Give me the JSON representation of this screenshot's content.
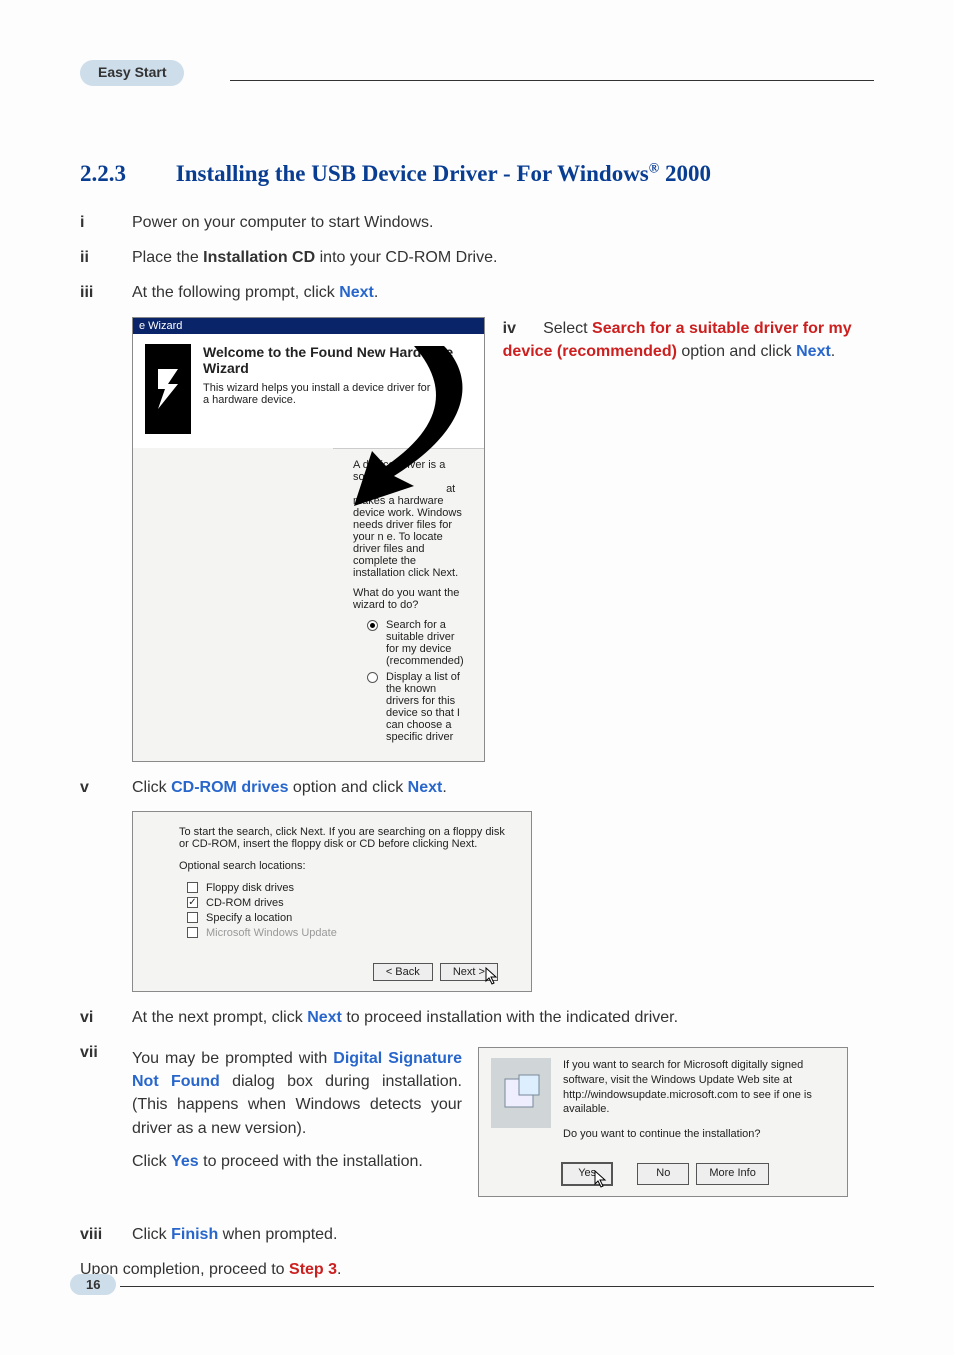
{
  "header_pill": "Easy Start",
  "section": {
    "number": "2.2.3",
    "title_main": "Installing the USB Device Driver - For Windows",
    "title_suffix": " 2000"
  },
  "steps": {
    "i": {
      "k": "i",
      "t1": "Power on your computer to start Windows."
    },
    "ii": {
      "k": "ii",
      "t1": "Place the ",
      "b1": "Installation CD",
      "t2": " into your CD-ROM Drive."
    },
    "iii": {
      "k": "iii",
      "t1": "At the following prompt, click ",
      "l1": "Next",
      "t2": "."
    },
    "iv": {
      "k": "iv",
      "t1": "Select ",
      "r1": "Search for a suitable driver for my device (recommended)",
      "t2": " option and click ",
      "l1": "Next",
      "t3": "."
    },
    "v": {
      "k": "v",
      "t1": "Click ",
      "l1": "CD-ROM drives",
      "t2": " option and click ",
      "l2": "Next",
      "t3": "."
    },
    "vi": {
      "k": "vi",
      "t1": "At the next prompt, click ",
      "l1": "Next",
      "t2": " to proceed installation with the indicated driver."
    },
    "vii": {
      "k": "vii",
      "p1a": "You may be prompted with ",
      "p1b": "Digital Signature Not Found",
      "p1c": " dialog box during installation.  (This happens when Windows detects your driver as a new version).",
      "p2a": "Click ",
      "p2b": "Yes",
      "p2c": " to proceed with the installation."
    },
    "viii": {
      "k": "viii",
      "t1": "Click ",
      "l1": "Finish",
      "t2": " when prompted."
    },
    "final": {
      "t1": "Upon completion, proceed to ",
      "l1": "Step 3",
      "t2": "."
    }
  },
  "wizard1": {
    "titlebar": "e Wizard",
    "heading": "Welcome to the Found New Hardware Wizard",
    "desc": "This wizard helps you install a device driver for a hardware device."
  },
  "wizard2": {
    "para1a": "A device driver is a software ",
    "para1b": "at makes a hardware device work. Windows needs driver files for your n",
    "para1c": "e. To locate driver files and complete the installation click Next.",
    "question": "What do you want the wizard to do?",
    "opt1": "Search for a suitable driver for my device (recommended)",
    "opt2": "Display a list of the known drivers for this device so that I can choose a specific driver"
  },
  "wizard3": {
    "para": "To start the search, click Next. If you are searching on a floppy disk or CD-ROM, insert the floppy disk or CD before clicking Next.",
    "label1": "Optional search locations:",
    "c1": "Floppy disk drives",
    "c2": "CD-ROM drives",
    "c3": "Specify a location",
    "c4": "Microsoft Windows Update",
    "back": "< Back",
    "next": "Next >"
  },
  "sigwin": {
    "msg1": "If you want to search for Microsoft digitally signed software, visit the Windows Update Web site at http://windowsupdate.microsoft.com to see if one is available.",
    "msg2": "Do you want to continue the installation?",
    "yes": "Yes",
    "no": "No",
    "more": "More Info"
  },
  "page_number": "16"
}
